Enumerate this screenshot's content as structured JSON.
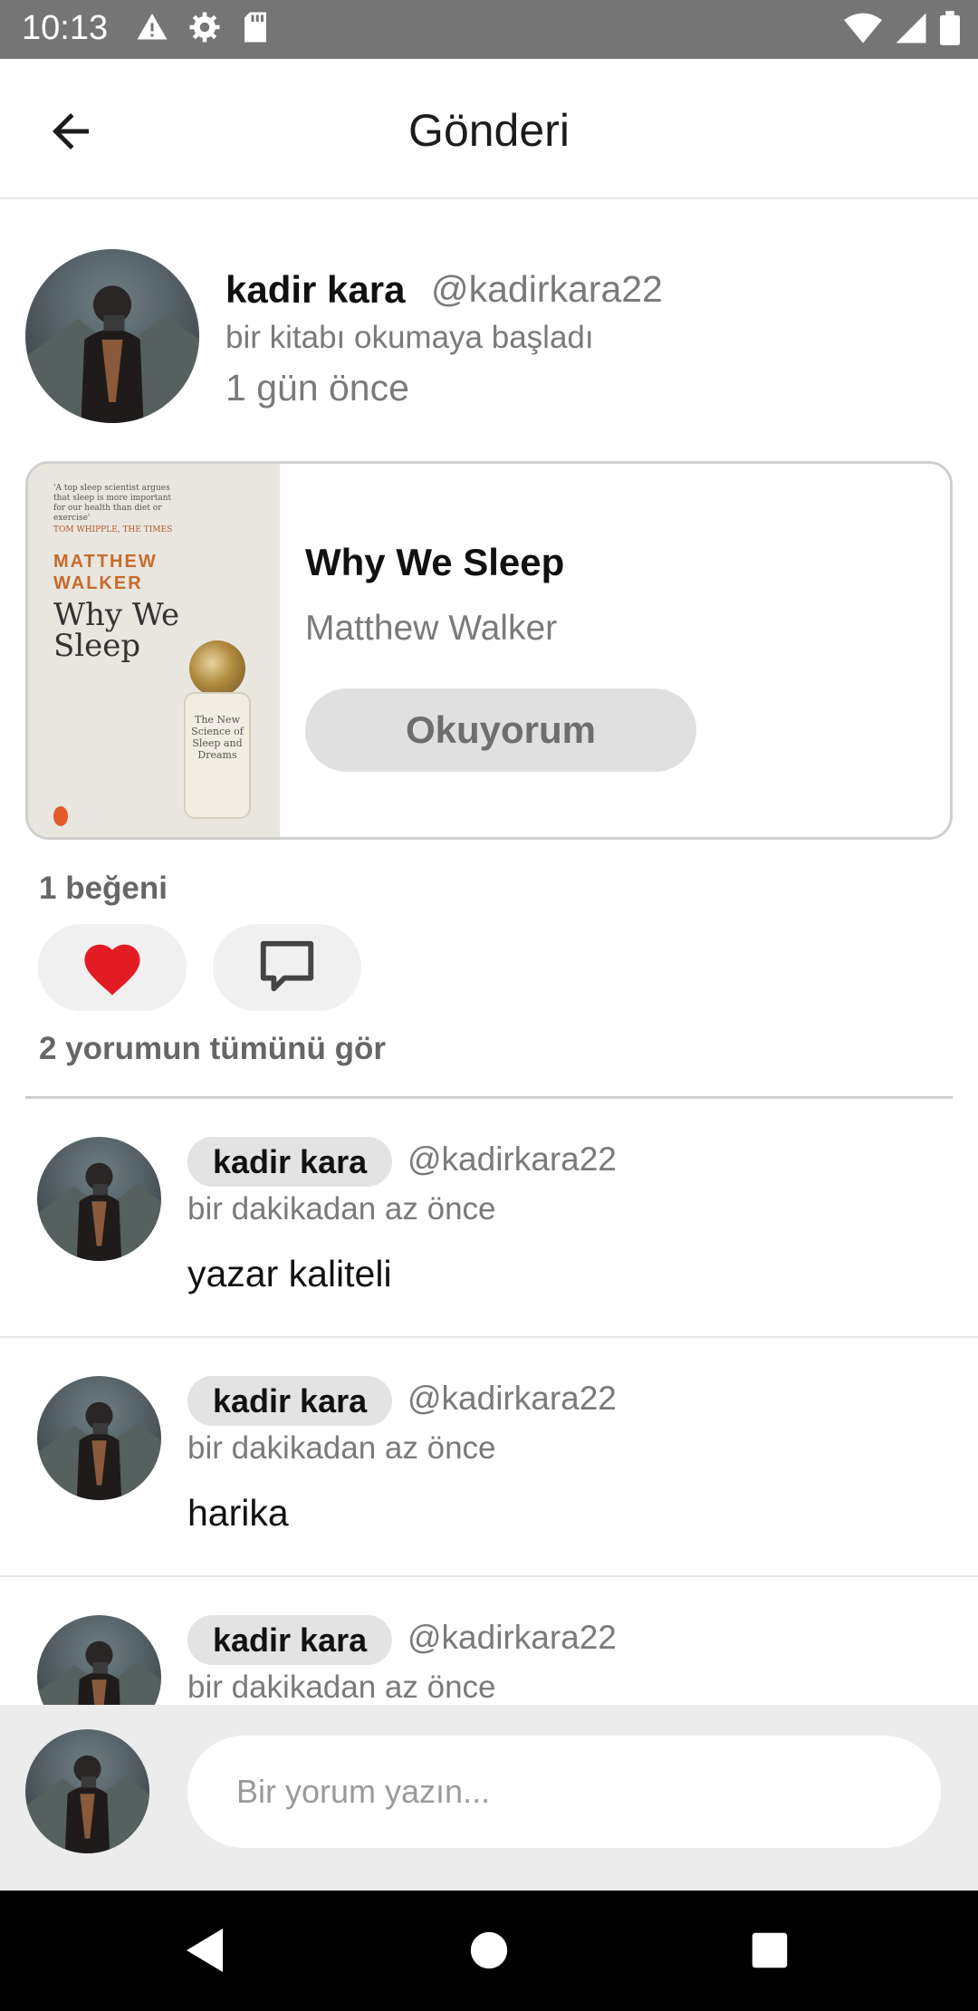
{
  "status_bar": {
    "time": "10:13",
    "left_icons": [
      "warning-icon",
      "settings-icon",
      "sd-card-icon"
    ],
    "right_icons": [
      "wifi-icon",
      "signal-icon",
      "battery-icon"
    ]
  },
  "app_bar": {
    "title": "Gönderi",
    "back_icon": "arrow-left-icon"
  },
  "post": {
    "user_name": "kadir kara",
    "user_handle": "@kadirkara22",
    "action": "bir kitabı okumaya başladı",
    "time_ago": "1 gün önce",
    "book": {
      "title": "Why We Sleep",
      "author": "Matthew Walker",
      "status_label": "Okuyorum",
      "cover": {
        "blurb": "'A top sleep scientist argues that sleep is more important for our health than diet or exercise'",
        "blurb_source": "TOM WHIPPLE, THE TIMES",
        "author": "MATTHEW WALKER",
        "title": "Why We Sleep",
        "subtitle": "The New Science of Sleep and Dreams"
      }
    },
    "likes_text": "1 beğeni",
    "liked": true,
    "like_color": "#e31b23",
    "see_all_comments": "2 yorumun tümünü gör"
  },
  "comments": [
    {
      "user_name": "kadir kara",
      "user_handle": "@kadirkara22",
      "time_ago": "bir dakikadan az önce",
      "text": "yazar kaliteli"
    },
    {
      "user_name": "kadir kara",
      "user_handle": "@kadirkara22",
      "time_ago": "bir dakikadan az önce",
      "text": "harika"
    },
    {
      "user_name": "kadir kara",
      "user_handle": "@kadirkara22",
      "time_ago": "bir dakikadan az önce",
      "text": ""
    }
  ],
  "composer": {
    "placeholder": "Bir yorum yazın...",
    "value": ""
  },
  "nav_bar": {
    "buttons": [
      "back-triangle-icon",
      "home-circle-icon",
      "recents-square-icon"
    ]
  }
}
